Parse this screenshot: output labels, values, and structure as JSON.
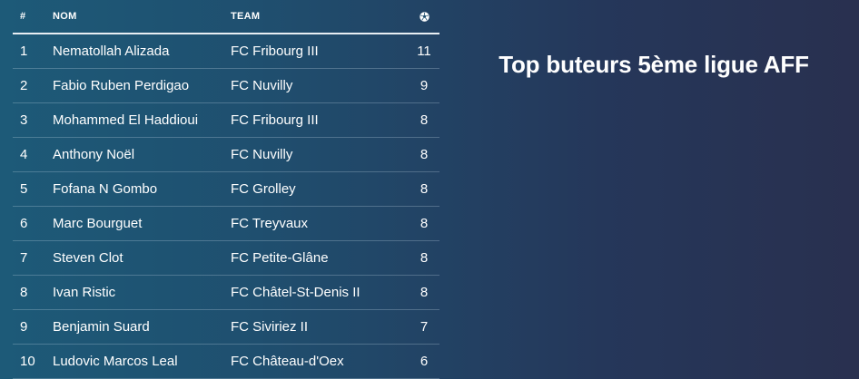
{
  "title": "Top buteurs 5ème ligue AFF",
  "table": {
    "headers": {
      "rank": "#",
      "name": "NOM",
      "team": "TEAM",
      "goals_icon": "soccer-ball-icon"
    },
    "rows": [
      {
        "rank": "1",
        "name": "Nematollah Alizada",
        "team": "FC Fribourg III",
        "goals": "11"
      },
      {
        "rank": "2",
        "name": "Fabio Ruben Perdigao",
        "team": "FC Nuvilly",
        "goals": "9"
      },
      {
        "rank": "3",
        "name": "Mohammed El Haddioui",
        "team": "FC Fribourg III",
        "goals": "8"
      },
      {
        "rank": "4",
        "name": "Anthony Noël",
        "team": "FC Nuvilly",
        "goals": "8"
      },
      {
        "rank": "5",
        "name": "Fofana N Gombo",
        "team": "FC Grolley",
        "goals": "8"
      },
      {
        "rank": "6",
        "name": "Marc Bourguet",
        "team": "FC Treyvaux",
        "goals": "8"
      },
      {
        "rank": "7",
        "name": "Steven Clot",
        "team": "FC Petite-Glâne",
        "goals": "8"
      },
      {
        "rank": "8",
        "name": "Ivan Ristic",
        "team": "FC Châtel-St-Denis II",
        "goals": "8"
      },
      {
        "rank": "9",
        "name": "Benjamin Suard",
        "team": "FC Siviriez II",
        "goals": "7"
      },
      {
        "rank": "10",
        "name": "Ludovic Marcos Leal",
        "team": "FC Château-d'Oex",
        "goals": "6"
      }
    ]
  }
}
